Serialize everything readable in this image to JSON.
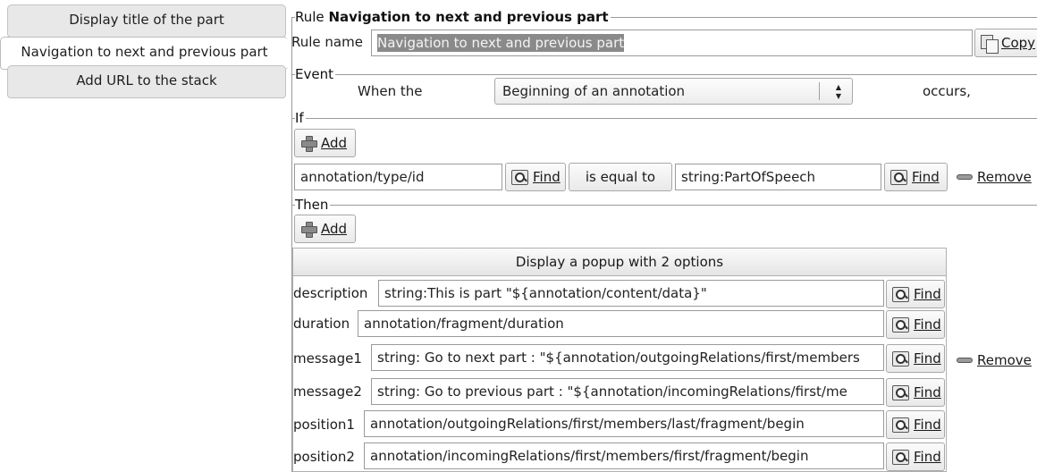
{
  "rules": [
    {
      "label": "Display title of the part",
      "selected": false
    },
    {
      "label": "Navigation to next and previous part",
      "selected": true
    },
    {
      "label": "Add URL to the stack",
      "selected": false
    }
  ],
  "editor": {
    "rule_prefix": "Rule",
    "rule_title": "Navigation to next and previous part",
    "rule_name_label": "Rule name",
    "rule_name_value": "Navigation to next and previous part",
    "copy_label": "Copy",
    "event": {
      "legend": "Event",
      "when_label": "When the",
      "selected_event": "Beginning of an annotation",
      "occurs_label": "occurs,"
    },
    "if": {
      "legend": "If",
      "add_label": "Add",
      "condition": {
        "left": "annotation/type/id",
        "find_label": "Find",
        "operator": "is equal to",
        "right": "string:PartOfSpeech",
        "find_label_2": "Find",
        "remove_label": "Remove"
      }
    },
    "then": {
      "legend": "Then",
      "add_label": "Add",
      "action_title": "Display a popup with 2 options",
      "params": [
        {
          "name": "description",
          "value": "string:This is part \"${annotation/content/data}\"",
          "find": "Find"
        },
        {
          "name": "duration",
          "value": "annotation/fragment/duration",
          "find": "Find"
        },
        {
          "name": "message1",
          "value": "string: Go to next part : \"${annotation/outgoingRelations/first/members",
          "find": "Find"
        },
        {
          "name": "message2",
          "value": "string: Go to previous part : \"${annotation/incomingRelations/first/me",
          "find": "Find"
        },
        {
          "name": "position1",
          "value": "annotation/outgoingRelations/first/members/last/fragment/begin",
          "find": "Find"
        },
        {
          "name": "position2",
          "value": "annotation/incomingRelations/first/members/first/fragment/begin",
          "find": "Find"
        }
      ],
      "remove_label": "Remove"
    }
  },
  "icons": {
    "find": "magnifier-icon",
    "add": "plus-icon",
    "remove": "minus-icon",
    "copy": "copy-icon",
    "dropdown": "updown-arrow-icon"
  },
  "colors": {
    "selection_bg": "#8a8a8a",
    "tab_bg": "#e8e8e8",
    "border": "#9a9a9a"
  }
}
